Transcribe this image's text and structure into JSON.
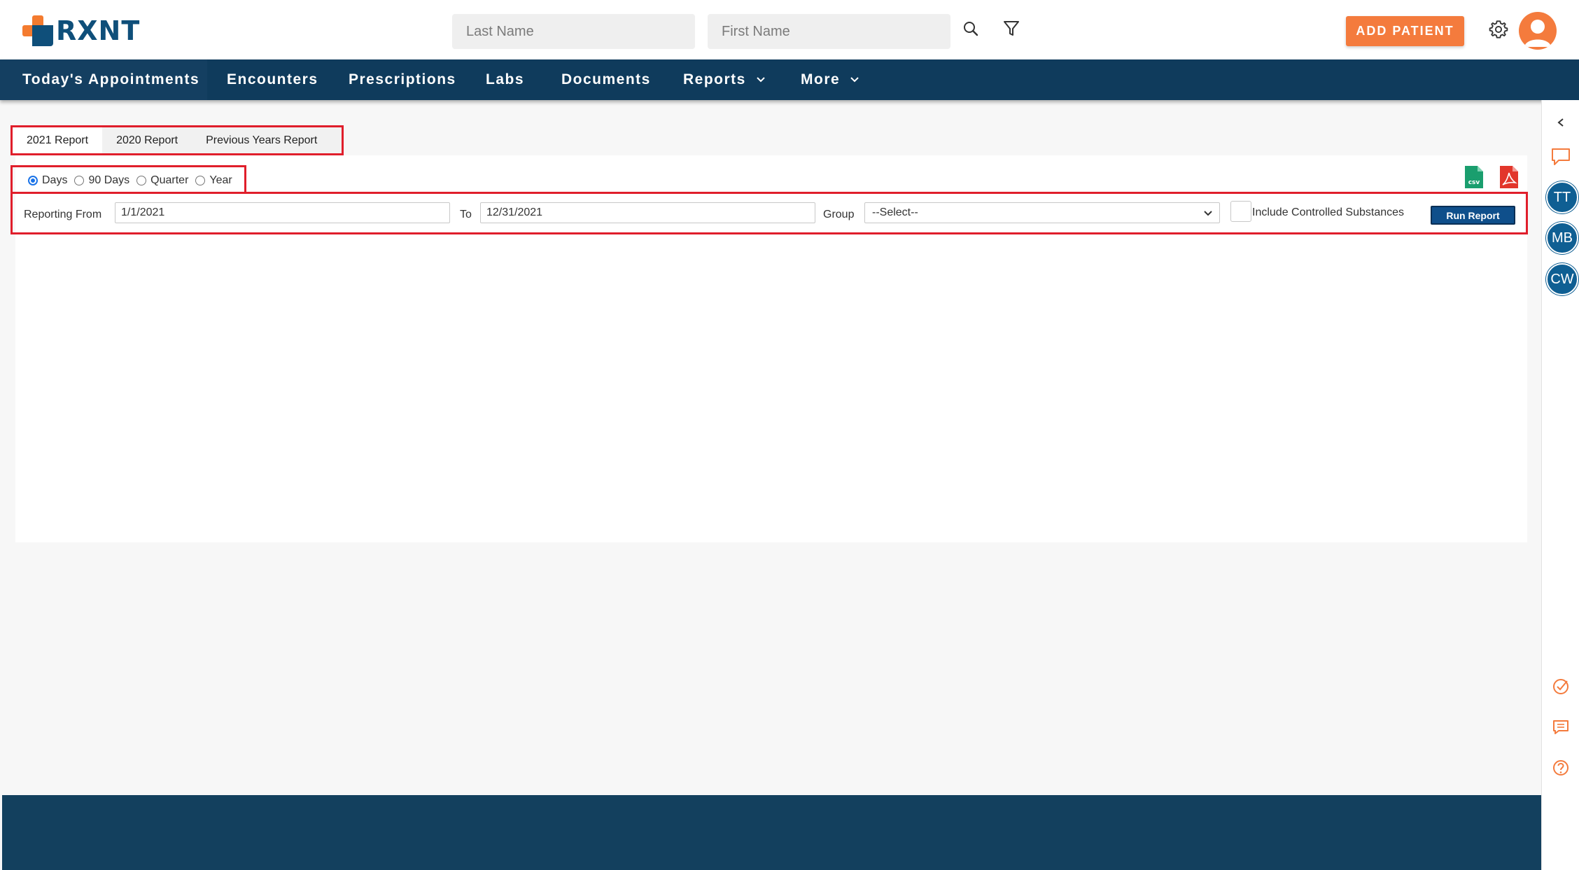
{
  "header": {
    "logo_text": "RXNT",
    "search": {
      "last_name_placeholder": "Last Name",
      "first_name_placeholder": "First Name"
    },
    "add_patient_label": "ADD PATIENT"
  },
  "nav": {
    "items": [
      {
        "label": "Today's Appointments"
      },
      {
        "label": "Encounters"
      },
      {
        "label": "Prescriptions"
      },
      {
        "label": "Labs"
      },
      {
        "label": "Documents"
      },
      {
        "label": "Reports"
      },
      {
        "label": "More"
      }
    ]
  },
  "report_tabs": [
    {
      "label": "2021 Report"
    },
    {
      "label": "2020 Report"
    },
    {
      "label": "Previous Years Report"
    }
  ],
  "period_options": [
    {
      "label": "Days",
      "selected": true
    },
    {
      "label": "90 Days",
      "selected": false
    },
    {
      "label": "Quarter",
      "selected": false
    },
    {
      "label": "Year",
      "selected": false
    }
  ],
  "export": {
    "csv_label": "csv"
  },
  "form": {
    "reporting_from_label": "Reporting From",
    "reporting_from_value": "1/1/2021",
    "to_label": "To",
    "to_value": "12/31/2021",
    "group_label": "Group",
    "group_value": "--Select--",
    "controlled_label": "Include Controlled Substances",
    "controlled_checked": false,
    "run_label": "Run Report"
  },
  "rail": {
    "badges": [
      "TT",
      "MB",
      "CW"
    ]
  },
  "colors": {
    "brand_blue": "#0f3b5c",
    "brand_orange": "#f47b3d",
    "highlight_red": "#e01e2b",
    "csv_green": "#1a9e6e",
    "pdf_red": "#e2362b"
  }
}
